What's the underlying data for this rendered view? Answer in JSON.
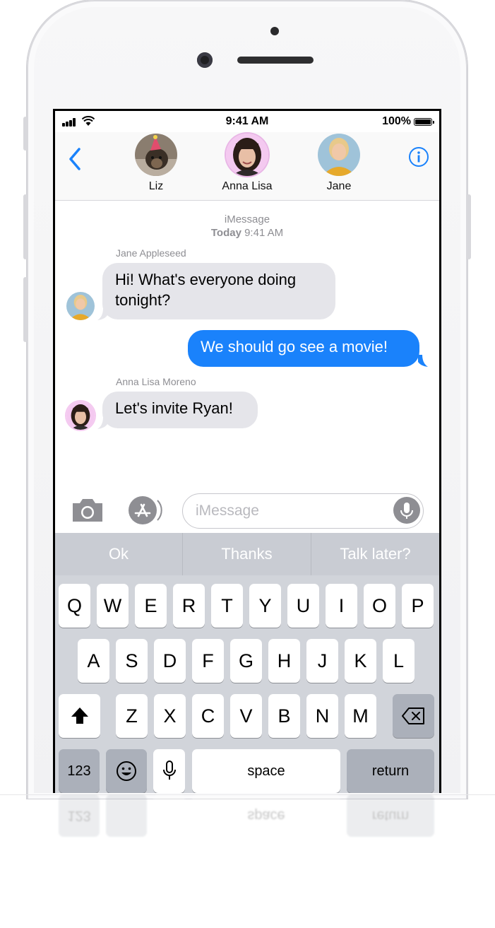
{
  "status_bar": {
    "time": "9:41 AM",
    "battery": "100%"
  },
  "header": {
    "contacts": [
      {
        "name": "Liz"
      },
      {
        "name": "Anna Lisa"
      },
      {
        "name": "Jane"
      }
    ]
  },
  "thread": {
    "service": "iMessage",
    "timestamp_day": "Today",
    "timestamp_time": "9:41 AM",
    "messages": [
      {
        "sender": "Jane Appleseed",
        "line1": "Hi! What's everyone doing",
        "line2": "tonight?"
      },
      {
        "text": "We should go see a movie!"
      },
      {
        "sender": "Anna Lisa Moreno",
        "text": "Let's invite Ryan!"
      }
    ]
  },
  "compose": {
    "placeholder": "iMessage"
  },
  "predictive": [
    "Ok",
    "Thanks",
    "Talk later?"
  ],
  "keyboard": {
    "row1": [
      "Q",
      "W",
      "E",
      "R",
      "T",
      "Y",
      "U",
      "I",
      "O",
      "P"
    ],
    "row2": [
      "A",
      "S",
      "D",
      "F",
      "G",
      "H",
      "J",
      "K",
      "L"
    ],
    "row3": [
      "Z",
      "X",
      "C",
      "V",
      "B",
      "N",
      "M"
    ],
    "numbers": "123",
    "space": "space",
    "return": "return"
  },
  "colors": {
    "blue": "#1a82fb",
    "incoming_bubble": "#e5e5ea",
    "keyboard_bg": "#d1d4da"
  }
}
